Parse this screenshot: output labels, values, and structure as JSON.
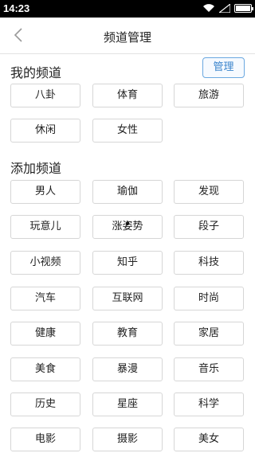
{
  "status": {
    "time": "14:23",
    "battery_level": 1.0
  },
  "nav": {
    "title": "频道管理"
  },
  "my_channels": {
    "title": "我的频道",
    "manage_label": "管理",
    "items": [
      "八卦",
      "体育",
      "旅游",
      "休闲",
      "女性"
    ]
  },
  "add_channels": {
    "title": "添加频道",
    "items": [
      "男人",
      "瑜伽",
      "发现",
      "玩意儿",
      "涨姿势",
      "段子",
      "小视频",
      "知乎",
      "科技",
      "汽车",
      "互联网",
      "时尚",
      "健康",
      "教育",
      "家居",
      "美食",
      "暴漫",
      "音乐",
      "历史",
      "星座",
      "科学",
      "电影",
      "摄影",
      "美女"
    ]
  }
}
